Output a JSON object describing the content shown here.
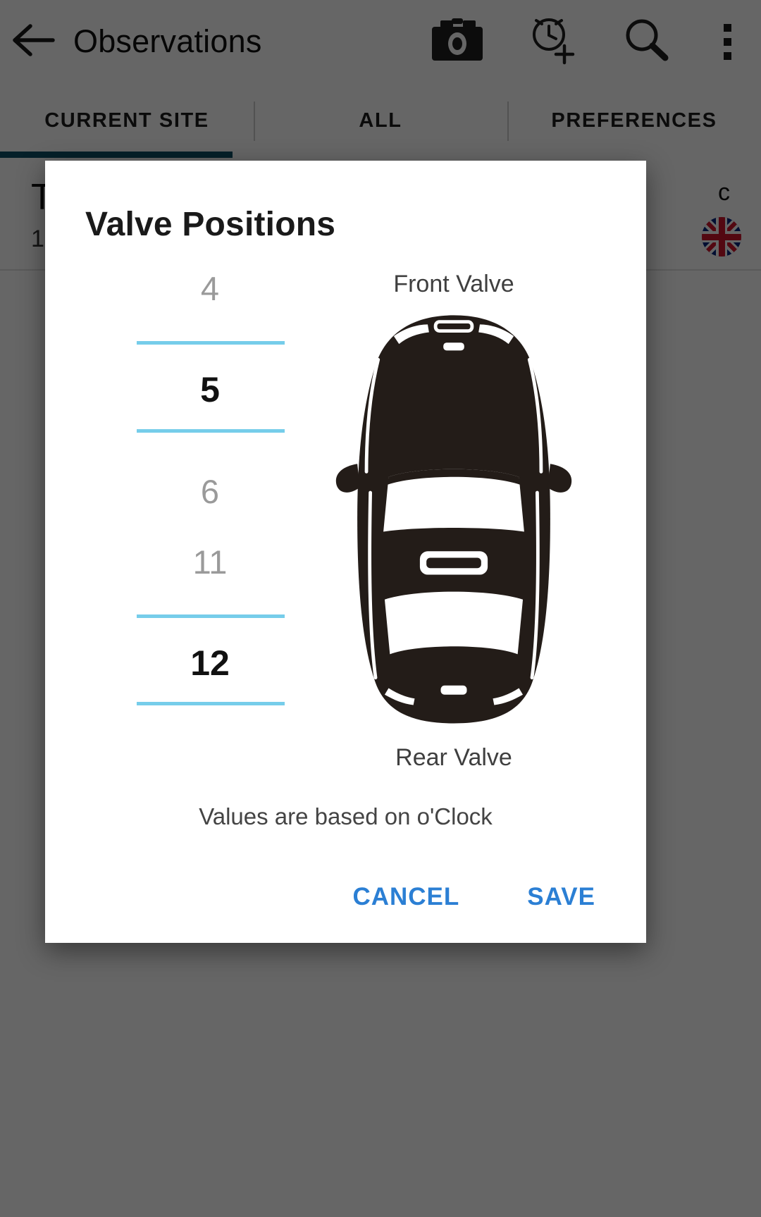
{
  "appbar": {
    "back_icon": "back-arrow-icon",
    "title": "Observations",
    "actions": [
      {
        "icon": "camera-icon",
        "name": "camera-button"
      },
      {
        "icon": "alarm-add-icon",
        "name": "add-timer-button"
      },
      {
        "icon": "search-icon",
        "name": "search-button"
      },
      {
        "icon": "overflow-menu-icon",
        "name": "overflow-menu-button"
      }
    ]
  },
  "tabs": {
    "items": [
      {
        "label": "CURRENT SITE",
        "selected": true
      },
      {
        "label": "ALL",
        "selected": false
      },
      {
        "label": "PREFERENCES",
        "selected": false
      }
    ],
    "indicator_color": "#0d5066"
  },
  "background_list": {
    "row_title": "T",
    "row_subtitle": "1",
    "row_right_text": "c",
    "flag_icon": "uk-flag-icon"
  },
  "dialog": {
    "title": "Valve Positions",
    "front_label": "Front Valve",
    "rear_label": "Rear Valve",
    "hint": "Values are based on o'Clock",
    "car_icon": "car-top-view-icon",
    "front_picker": {
      "name": "front-valve-picker",
      "previous": "4",
      "selected": "5",
      "next": "6"
    },
    "rear_picker": {
      "name": "rear-valve-picker",
      "previous": "11",
      "selected": "12",
      "next": ""
    },
    "buttons": {
      "cancel": "CANCEL",
      "save": "SAVE"
    }
  },
  "colors": {
    "divider": "#76cdea",
    "action_blue": "#2b7fd4",
    "tab_indicator": "#0d5066",
    "car": "#231c18",
    "scrim": "rgba(0,0,0,0.60)"
  }
}
